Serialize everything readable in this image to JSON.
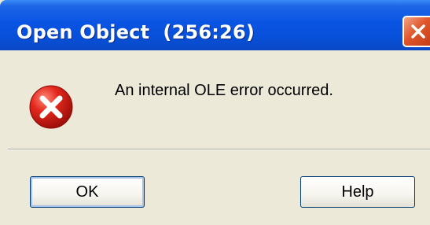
{
  "dialog": {
    "title": "Open Object  (256:26)",
    "message": "An internal OLE error occurred.",
    "icon": "error-icon",
    "ok_label": "OK",
    "help_label": "Help"
  },
  "colors": {
    "titlebar": "#0a54e3",
    "body": "#ece9d8",
    "close": "#e0562b",
    "error_icon": "#d0201a"
  }
}
